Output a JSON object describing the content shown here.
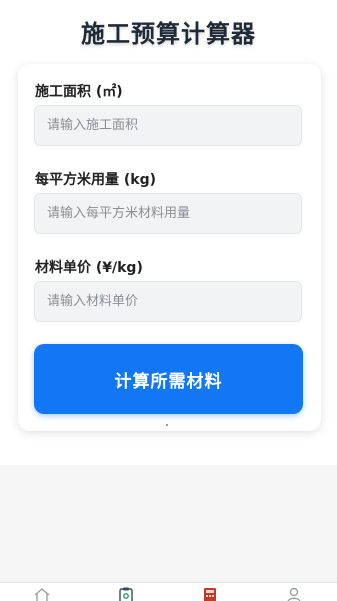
{
  "app": {
    "title": "施工预算计算器"
  },
  "form": {
    "area": {
      "label": "施工面积 (㎡)",
      "placeholder": "请输入施工面积"
    },
    "usage": {
      "label": "每平方米用量 (kg)",
      "placeholder": "请输入每平方米材料用量"
    },
    "price": {
      "label": "材料单价 (¥/kg)",
      "placeholder": "请输入材料单价"
    },
    "submit_label": "计算所需材料"
  },
  "tabbar": {
    "items": [
      {
        "icon": "home-icon",
        "active": false
      },
      {
        "icon": "clipboard-icon",
        "active": false
      },
      {
        "icon": "calculator-icon",
        "active": true
      },
      {
        "icon": "user-icon",
        "active": false
      }
    ],
    "active_color": "#c0392b",
    "inactive_color": "#9aa0a6"
  },
  "colors": {
    "accent": "#1277f5"
  }
}
